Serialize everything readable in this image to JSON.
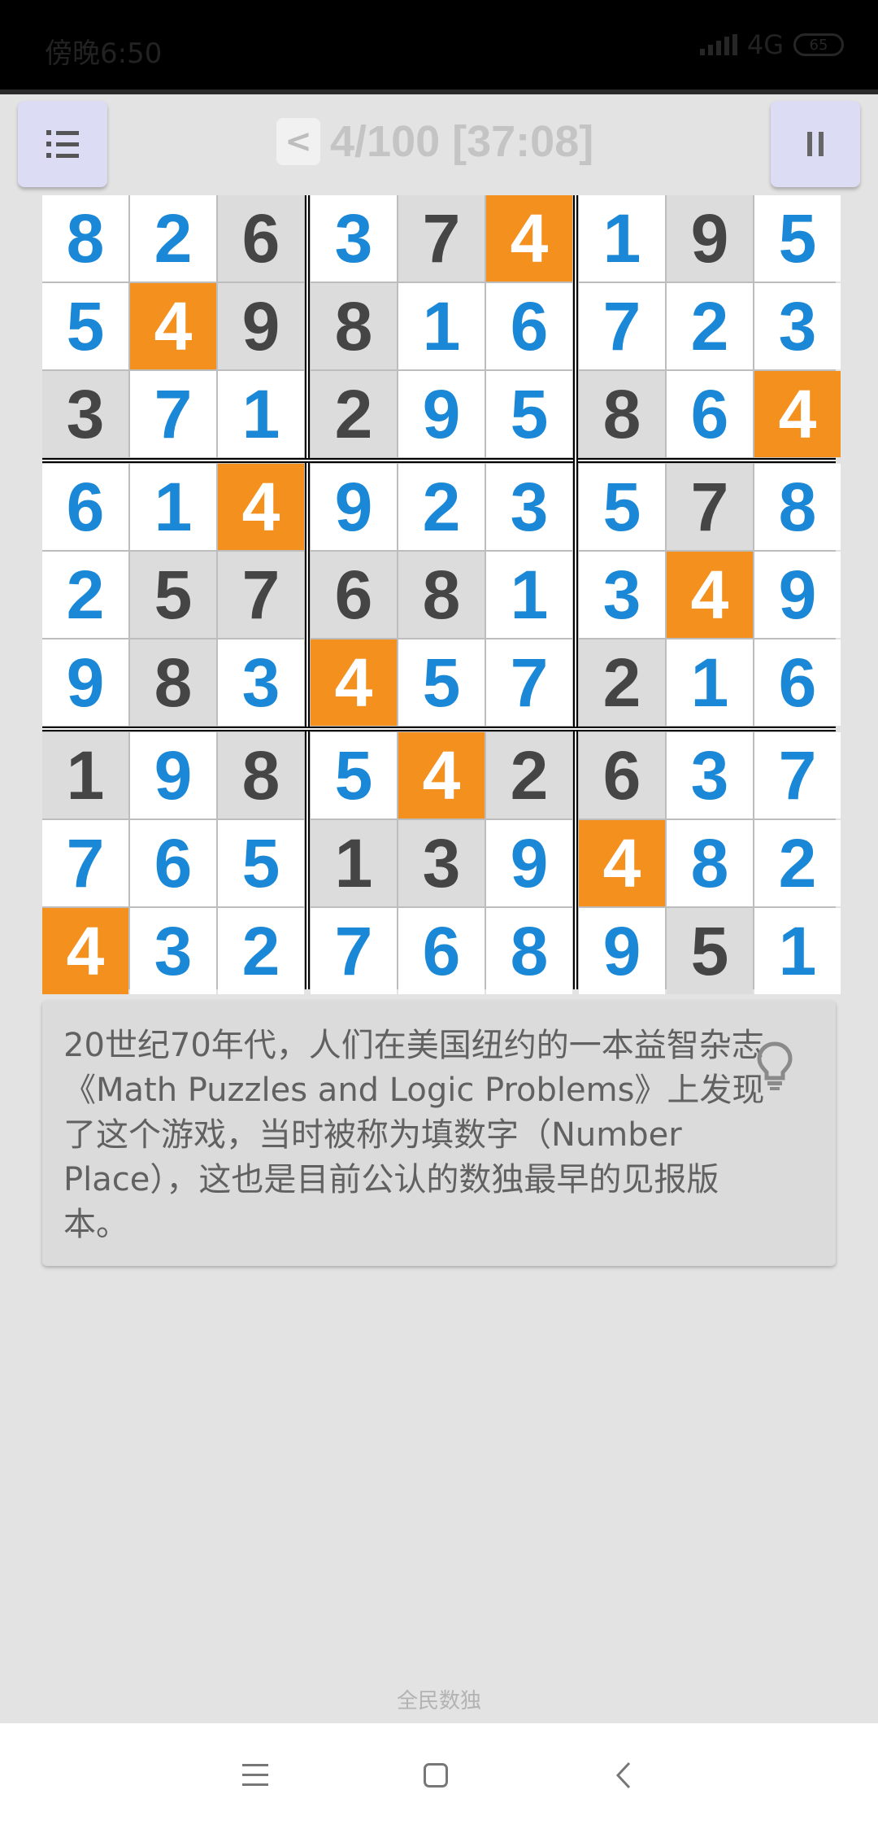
{
  "status_bar": {
    "time": "傍晚6:50",
    "network": "4G",
    "battery": "65"
  },
  "header": {
    "back_label": "<",
    "level": "4/100",
    "timer": "[37:08]",
    "title": "4/100 [37:08]",
    "menu_icon": "list-icon",
    "pause_icon": "pause-icon"
  },
  "board": {
    "digits": [
      [
        8,
        2,
        6,
        3,
        7,
        4,
        1,
        9,
        5
      ],
      [
        5,
        4,
        9,
        8,
        1,
        6,
        7,
        2,
        3
      ],
      [
        3,
        7,
        1,
        2,
        9,
        5,
        8,
        6,
        4
      ],
      [
        6,
        1,
        4,
        9,
        2,
        3,
        5,
        7,
        8
      ],
      [
        2,
        5,
        7,
        6,
        8,
        1,
        3,
        4,
        9
      ],
      [
        9,
        8,
        3,
        4,
        5,
        7,
        2,
        1,
        6
      ],
      [
        1,
        9,
        8,
        5,
        4,
        2,
        6,
        3,
        7
      ],
      [
        7,
        6,
        5,
        1,
        3,
        9,
        4,
        8,
        2
      ],
      [
        4,
        3,
        2,
        7,
        6,
        8,
        9,
        5,
        1
      ]
    ],
    "cell_types": [
      [
        "U",
        "U",
        "G",
        "U",
        "G",
        "H",
        "U",
        "G",
        "U"
      ],
      [
        "U",
        "H",
        "G",
        "G",
        "U",
        "U",
        "U",
        "U",
        "U"
      ],
      [
        "G",
        "U",
        "U",
        "G",
        "U",
        "U",
        "G",
        "U",
        "H"
      ],
      [
        "U",
        "U",
        "H",
        "U",
        "U",
        "U",
        "U",
        "G",
        "U"
      ],
      [
        "U",
        "G",
        "G",
        "G",
        "G",
        "U",
        "U",
        "H",
        "U"
      ],
      [
        "U",
        "G",
        "U",
        "H",
        "U",
        "U",
        "G",
        "U",
        "U"
      ],
      [
        "G",
        "U",
        "G",
        "U",
        "H",
        "G",
        "G",
        "U",
        "U"
      ],
      [
        "U",
        "U",
        "U",
        "G",
        "G",
        "U",
        "H",
        "U",
        "U"
      ],
      [
        "H",
        "U",
        "U",
        "U",
        "U",
        "U",
        "U",
        "G",
        "U"
      ]
    ],
    "colors": {
      "given_bg": "#dcdcdc",
      "given_text": "#454545",
      "user_bg": "#ffffff",
      "user_text": "#1a88d6",
      "highlight_bg": "#f4901e",
      "highlight_text": "#ffffff"
    }
  },
  "tip": {
    "text": "20世纪70年代，人们在美国纽约的一本益智杂志《Math Puzzles and Logic Problems》上发现了这个游戏，当时被称为填数字（Number Place），这也是目前公认的数独最早的见报版本。",
    "icon": "lightbulb-icon"
  },
  "footer": {
    "brand": "全民数独"
  },
  "nav_bar": {
    "icons": [
      "menu-icon",
      "home-icon",
      "back-icon"
    ]
  }
}
